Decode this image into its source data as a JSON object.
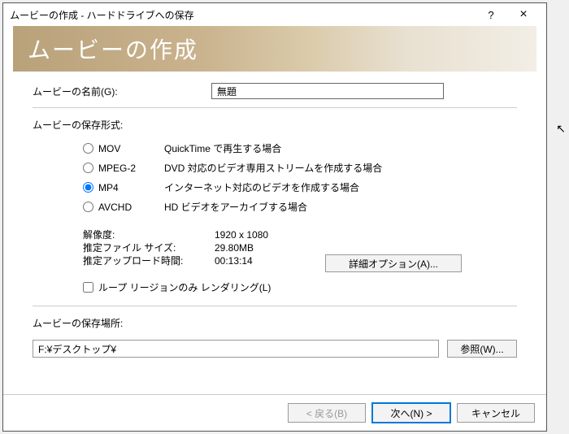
{
  "window": {
    "title": "ムービーの作成 - ハードドライブへの保存",
    "help": "?",
    "close": "×"
  },
  "banner": {
    "title": "ムービーの作成"
  },
  "name": {
    "label": "ムービーの名前(G):",
    "value": "無題"
  },
  "format": {
    "section": "ムービーの保存形式:",
    "options": [
      {
        "label": "MOV",
        "desc": "QuickTime で再生する場合"
      },
      {
        "label": "MPEG-2",
        "desc": "DVD 対応のビデオ専用ストリームを作成する場合"
      },
      {
        "label": "MP4",
        "desc": "インターネット対応のビデオを作成する場合"
      },
      {
        "label": "AVCHD",
        "desc": "HD ビデオをアーカイブする場合"
      }
    ],
    "selected": 2
  },
  "info": {
    "resolution_label": "解像度:",
    "resolution_value": "1920 x 1080",
    "filesize_label": "推定ファイル サイズ:",
    "filesize_value": "29.80MB",
    "upload_label": "推定アップロード時間:",
    "upload_value": "00:13:14",
    "advanced": "詳細オプション(A)..."
  },
  "loop": {
    "label": "ループ リージョンのみ レンダリング(L)"
  },
  "location": {
    "section": "ムービーの保存場所:",
    "path": "F:¥デスクトップ¥",
    "browse": "参照(W)..."
  },
  "footer": {
    "back": "< 戻る(B)",
    "next": "次へ(N) >",
    "cancel": "キャンセル"
  }
}
